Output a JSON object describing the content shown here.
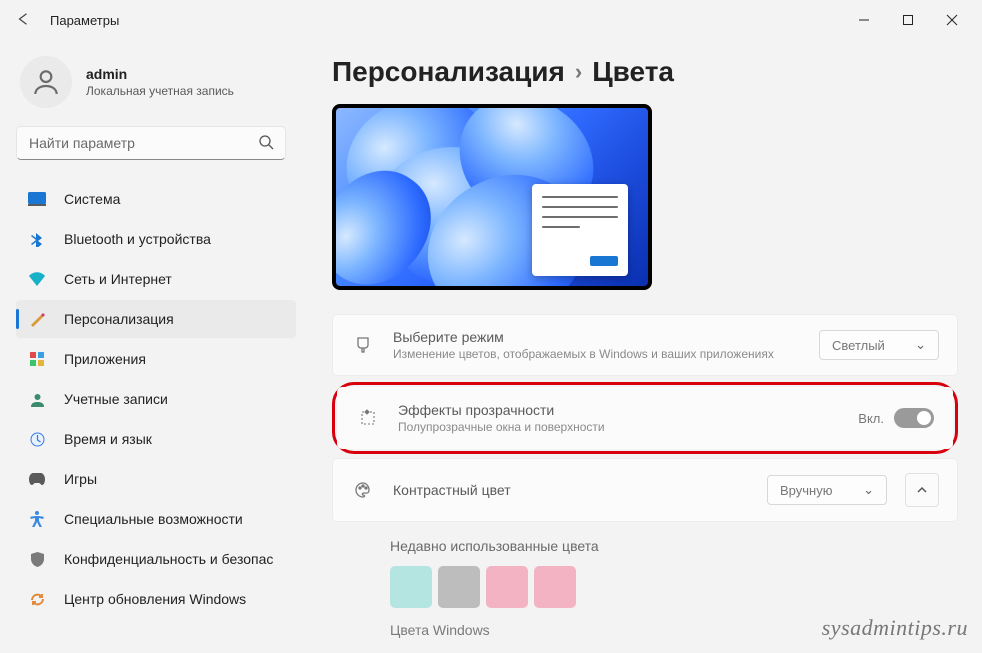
{
  "titlebar": {
    "title": "Параметры"
  },
  "user": {
    "name": "admin",
    "subtitle": "Локальная учетная запись"
  },
  "search": {
    "placeholder": "Найти параметр"
  },
  "nav": {
    "system": "Система",
    "bluetooth": "Bluetooth и устройства",
    "network": "Сеть и Интернет",
    "personalization": "Персонализация",
    "apps": "Приложения",
    "accounts": "Учетные записи",
    "time": "Время и язык",
    "gaming": "Игры",
    "accessibility": "Специальные возможности",
    "privacy": "Конфиденциальность и безопас",
    "update": "Центр обновления Windows"
  },
  "breadcrumb": {
    "parent": "Персонализация",
    "current": "Цвета"
  },
  "mode_card": {
    "title": "Выберите режим",
    "subtitle": "Изменение цветов, отображаемых в Windows и ваших приложениях",
    "value": "Светлый"
  },
  "transparency_card": {
    "title": "Эффекты прозрачности",
    "subtitle": "Полупрозрачные окна и поверхности",
    "state": "Вкл."
  },
  "accent_card": {
    "title": "Контрастный цвет",
    "value": "Вручную"
  },
  "recent_colors": {
    "title": "Недавно использованные цвета",
    "swatches": [
      "#b4e5e1",
      "#bdbdbd",
      "#f4b3c2",
      "#f4b3c2"
    ]
  },
  "next_section": "Цвета Windows",
  "watermark": "sysadmintips.ru"
}
